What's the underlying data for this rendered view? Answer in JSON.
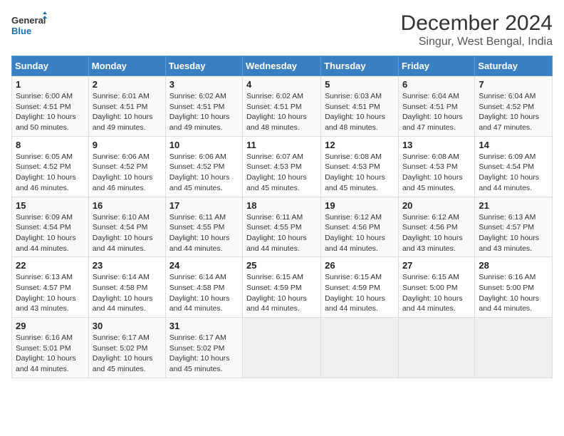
{
  "logo": {
    "general": "General",
    "blue": "Blue"
  },
  "title": "December 2024",
  "subtitle": "Singur, West Bengal, India",
  "days_of_week": [
    "Sunday",
    "Monday",
    "Tuesday",
    "Wednesday",
    "Thursday",
    "Friday",
    "Saturday"
  ],
  "weeks": [
    [
      {
        "num": "1",
        "sunrise": "6:00 AM",
        "sunset": "4:51 PM",
        "daylight": "10 hours and 50 minutes."
      },
      {
        "num": "2",
        "sunrise": "6:01 AM",
        "sunset": "4:51 PM",
        "daylight": "10 hours and 49 minutes."
      },
      {
        "num": "3",
        "sunrise": "6:02 AM",
        "sunset": "4:51 PM",
        "daylight": "10 hours and 49 minutes."
      },
      {
        "num": "4",
        "sunrise": "6:02 AM",
        "sunset": "4:51 PM",
        "daylight": "10 hours and 48 minutes."
      },
      {
        "num": "5",
        "sunrise": "6:03 AM",
        "sunset": "4:51 PM",
        "daylight": "10 hours and 48 minutes."
      },
      {
        "num": "6",
        "sunrise": "6:04 AM",
        "sunset": "4:51 PM",
        "daylight": "10 hours and 47 minutes."
      },
      {
        "num": "7",
        "sunrise": "6:04 AM",
        "sunset": "4:52 PM",
        "daylight": "10 hours and 47 minutes."
      }
    ],
    [
      {
        "num": "8",
        "sunrise": "6:05 AM",
        "sunset": "4:52 PM",
        "daylight": "10 hours and 46 minutes."
      },
      {
        "num": "9",
        "sunrise": "6:06 AM",
        "sunset": "4:52 PM",
        "daylight": "10 hours and 46 minutes."
      },
      {
        "num": "10",
        "sunrise": "6:06 AM",
        "sunset": "4:52 PM",
        "daylight": "10 hours and 45 minutes."
      },
      {
        "num": "11",
        "sunrise": "6:07 AM",
        "sunset": "4:53 PM",
        "daylight": "10 hours and 45 minutes."
      },
      {
        "num": "12",
        "sunrise": "6:08 AM",
        "sunset": "4:53 PM",
        "daylight": "10 hours and 45 minutes."
      },
      {
        "num": "13",
        "sunrise": "6:08 AM",
        "sunset": "4:53 PM",
        "daylight": "10 hours and 45 minutes."
      },
      {
        "num": "14",
        "sunrise": "6:09 AM",
        "sunset": "4:54 PM",
        "daylight": "10 hours and 44 minutes."
      }
    ],
    [
      {
        "num": "15",
        "sunrise": "6:09 AM",
        "sunset": "4:54 PM",
        "daylight": "10 hours and 44 minutes."
      },
      {
        "num": "16",
        "sunrise": "6:10 AM",
        "sunset": "4:54 PM",
        "daylight": "10 hours and 44 minutes."
      },
      {
        "num": "17",
        "sunrise": "6:11 AM",
        "sunset": "4:55 PM",
        "daylight": "10 hours and 44 minutes."
      },
      {
        "num": "18",
        "sunrise": "6:11 AM",
        "sunset": "4:55 PM",
        "daylight": "10 hours and 44 minutes."
      },
      {
        "num": "19",
        "sunrise": "6:12 AM",
        "sunset": "4:56 PM",
        "daylight": "10 hours and 44 minutes."
      },
      {
        "num": "20",
        "sunrise": "6:12 AM",
        "sunset": "4:56 PM",
        "daylight": "10 hours and 43 minutes."
      },
      {
        "num": "21",
        "sunrise": "6:13 AM",
        "sunset": "4:57 PM",
        "daylight": "10 hours and 43 minutes."
      }
    ],
    [
      {
        "num": "22",
        "sunrise": "6:13 AM",
        "sunset": "4:57 PM",
        "daylight": "10 hours and 43 minutes."
      },
      {
        "num": "23",
        "sunrise": "6:14 AM",
        "sunset": "4:58 PM",
        "daylight": "10 hours and 44 minutes."
      },
      {
        "num": "24",
        "sunrise": "6:14 AM",
        "sunset": "4:58 PM",
        "daylight": "10 hours and 44 minutes."
      },
      {
        "num": "25",
        "sunrise": "6:15 AM",
        "sunset": "4:59 PM",
        "daylight": "10 hours and 44 minutes."
      },
      {
        "num": "26",
        "sunrise": "6:15 AM",
        "sunset": "4:59 PM",
        "daylight": "10 hours and 44 minutes."
      },
      {
        "num": "27",
        "sunrise": "6:15 AM",
        "sunset": "5:00 PM",
        "daylight": "10 hours and 44 minutes."
      },
      {
        "num": "28",
        "sunrise": "6:16 AM",
        "sunset": "5:00 PM",
        "daylight": "10 hours and 44 minutes."
      }
    ],
    [
      {
        "num": "29",
        "sunrise": "6:16 AM",
        "sunset": "5:01 PM",
        "daylight": "10 hours and 44 minutes."
      },
      {
        "num": "30",
        "sunrise": "6:17 AM",
        "sunset": "5:02 PM",
        "daylight": "10 hours and 45 minutes."
      },
      {
        "num": "31",
        "sunrise": "6:17 AM",
        "sunset": "5:02 PM",
        "daylight": "10 hours and 45 minutes."
      },
      null,
      null,
      null,
      null
    ]
  ]
}
